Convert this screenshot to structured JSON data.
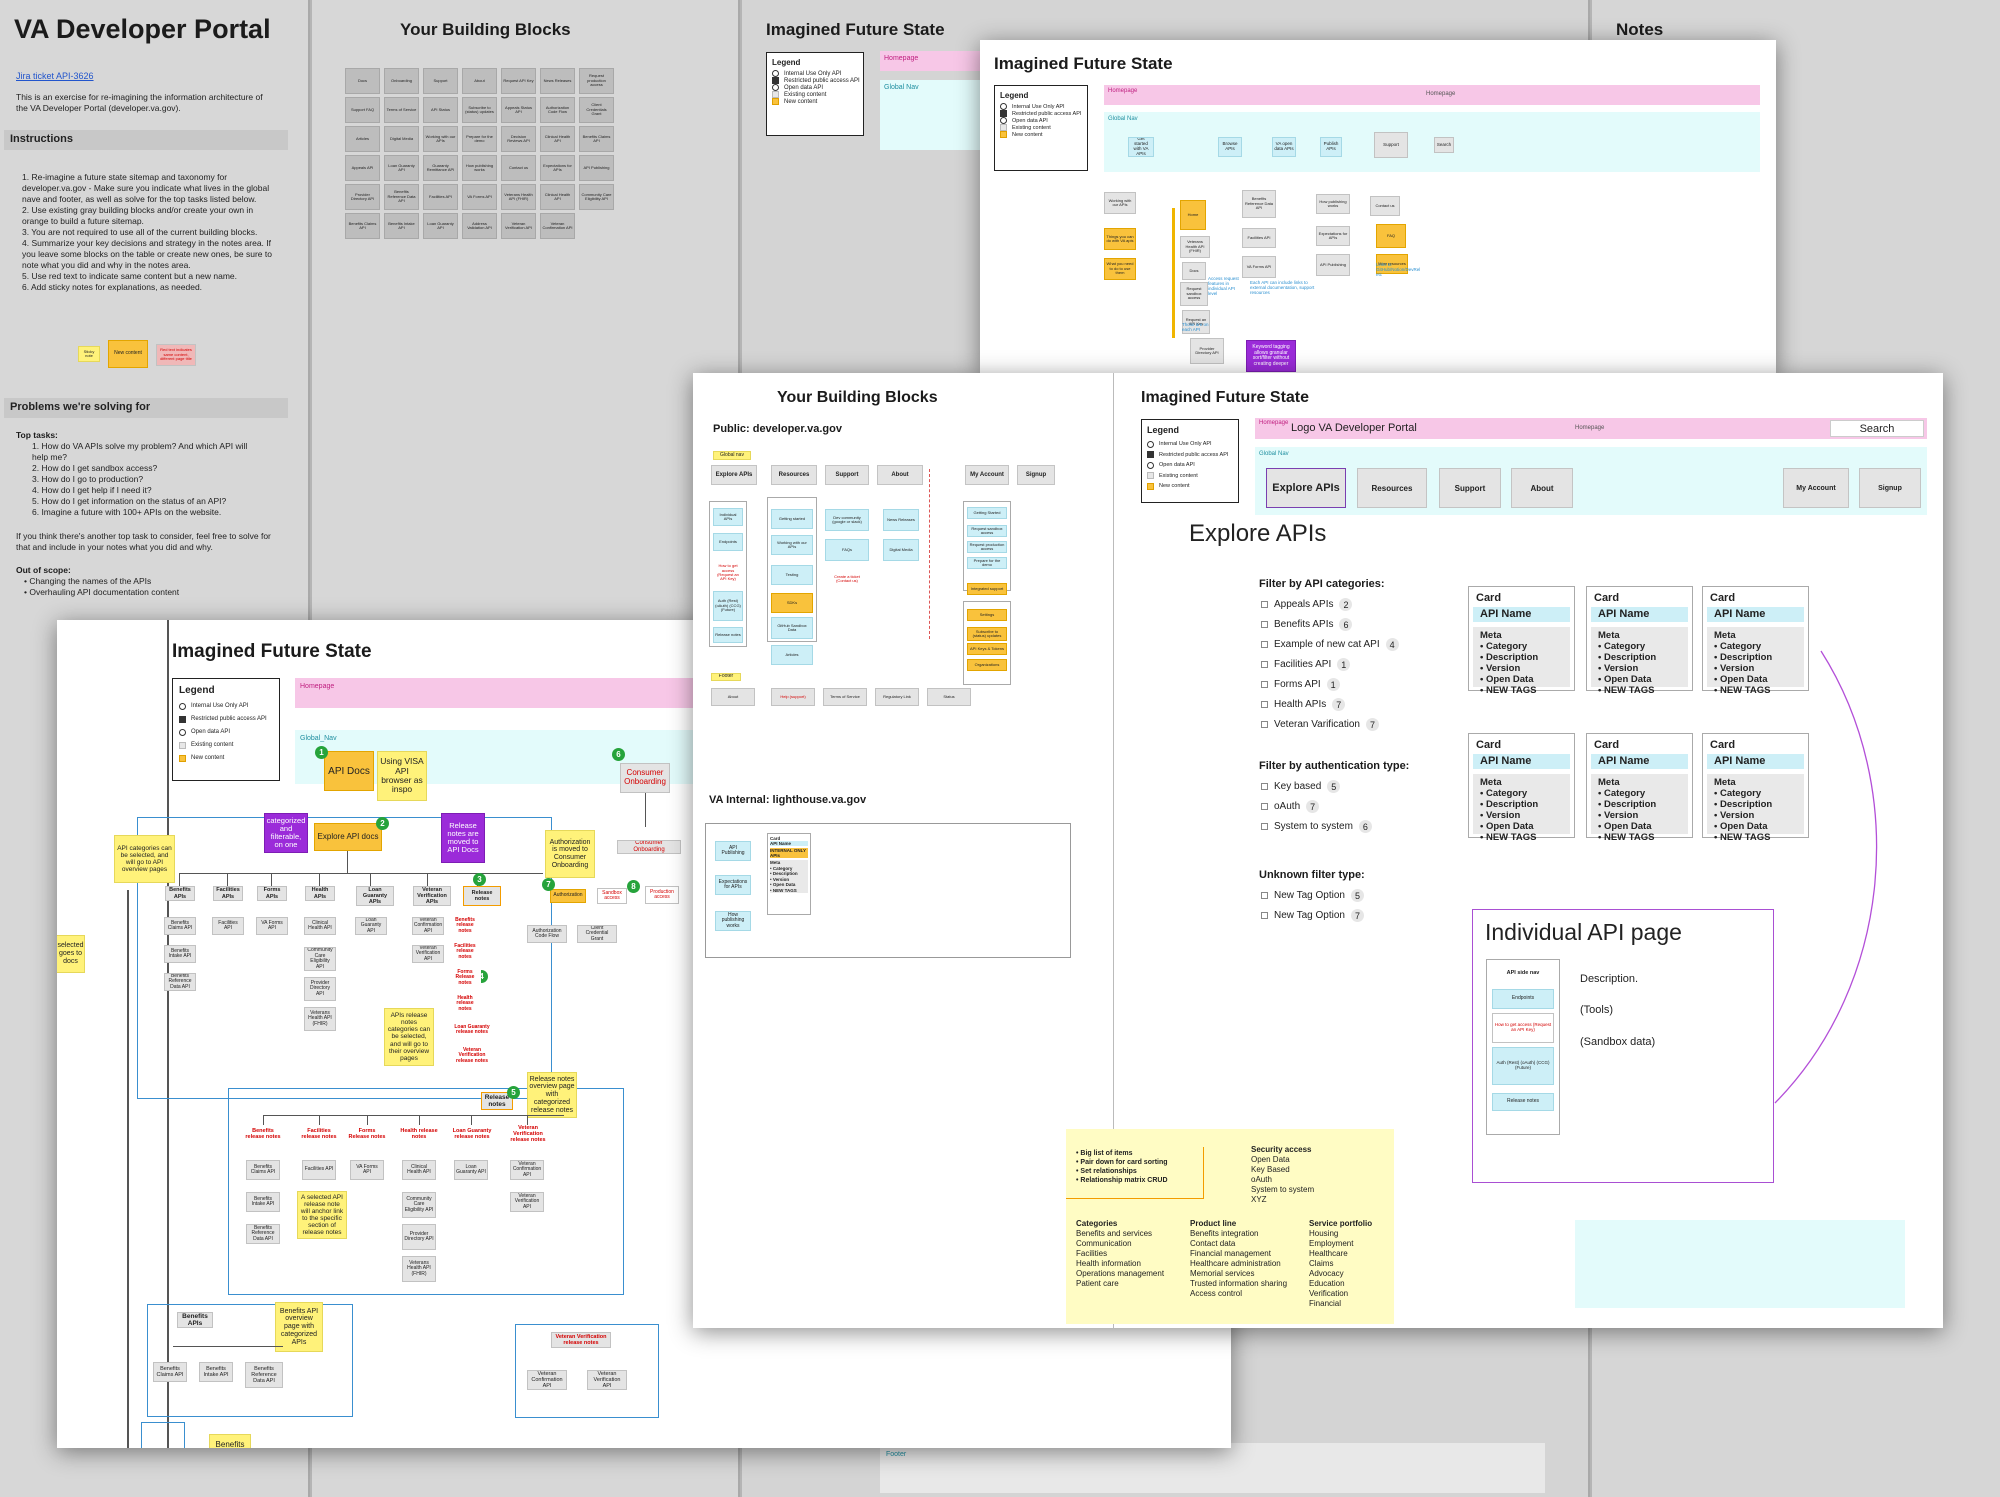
{
  "portal": {
    "title": "VA Developer Portal",
    "jira_link": "Jira ticket API-3626",
    "intro": "This is an exercise for re-imagining the information architecture of the VA Developer Portal (developer.va.gov).",
    "instructions_heading": "Instructions",
    "instructions": [
      "1. Re-imagine a future state sitemap and taxonomy for developer.va.gov - Make sure you indicate what lives in the global nave and footer, as well as solve for the top tasks listed below.",
      "2. Use existing gray building blocks and/or create your own in orange to build a future sitemap.",
      "3. You are not required to use all of the current building blocks.",
      "4. Summarize your key decisions and strategy in the notes area. If you leave some blocks on the table or create new ones, be sure to note what you did and why in the notes area.",
      "5. Use red text to indicate same content but a new name.",
      "6. Add sticky notes for explanations, as needed."
    ],
    "swatches": [
      "Sticky note",
      "New content",
      "Red text indicates same content, different page title"
    ],
    "problems_heading": "Problems we're solving for",
    "top_tasks_label": "Top tasks:",
    "top_tasks": [
      "1. How do VA APIs solve my problem? And which API will help me?",
      "2. How do I get sandbox access?",
      "3. How do I go to production?",
      "4. How do I get help if I need it?",
      "5. How do I get information on the status of an API?",
      "6. Imagine a future with 100+ APIs on the website."
    ],
    "other_task_note": "If you think there's another top task to consider, feel free to solve for that and include in your notes what you did and why.",
    "out_of_scope_label": "Out of scope:",
    "out_of_scope": [
      "Changing the names of the APIs",
      "Overhauling API documentation content"
    ]
  },
  "bg_headers": {
    "building_blocks": "Your Building Blocks",
    "future_state": "Imagined Future State",
    "notes": "Notes",
    "footer": "Footer"
  },
  "legend": {
    "title": "Legend",
    "items": [
      "Internal Use Only API",
      "Restricted public access API",
      "Open data API",
      "Existing content",
      "New content"
    ]
  },
  "bg_blocks": [
    "Docs",
    "Onboarding",
    "Support",
    "About",
    "Request API Key",
    "News Releases",
    "Request production access",
    "Support FAQ",
    "Terms of Service",
    "API Status",
    "Subscribe to (status) updates",
    "Appeals Status API",
    "Authorization Code Flow",
    "Client Credentials Grant",
    "Articles",
    "Digital Media",
    "Working with our APIs",
    "Prepare for the demo",
    "Decision Reviews API",
    "Clinical Health API",
    "Benefits Claims API",
    "Appeals API",
    "Loan Guaranty API",
    "Guaranty Remittance API",
    "How publishing works",
    "Contact us",
    "Expectations for APIs",
    "API Publishing",
    "Provider Directory API",
    "Benefits Reference Data API",
    "Facilities API",
    "VA Forms API",
    "Veterans Health API (FHIR)",
    "Clinical Health API",
    "Community Care Eligibility API",
    "Benefits Claims API",
    "Benefits Intake API",
    "Loan Guaranty API",
    "Address Validation API",
    "Veteran Verification API",
    "Veteran Confirmation API"
  ],
  "top_sheet": {
    "title": "Imagined Future State",
    "homepage": "Homepage",
    "global_nav": "Global Nav",
    "nav": [
      "Get started with VA APIs",
      "Browse APIs",
      "VA open data APIs",
      "Publish APIs",
      "Support",
      "Search"
    ],
    "tree": [
      "Working with our APIs",
      "Home",
      "Benefits Reference Data API",
      "How publishing works",
      "Contact us",
      "Things you can do with VA apis",
      "Veterans Health API (FHIR)",
      "Facilities API",
      "Expectations for APIs",
      "FAQ",
      "What you need to do to use them",
      "Docs",
      "VA Forms API",
      "API Publishing",
      "More resources",
      "Request sandbox access",
      "Request an API Key",
      "Provider Directory API"
    ],
    "notes": [
      "Access request features in individual API level",
      "Each API can include links to external documentation, support resources",
      "Keyword tagging allows granular sort/filter without creating deeper",
      "Links to GitHub/Notion/DevRel etc",
      "Those are on each API"
    ]
  },
  "mid_sheet": {
    "blocks_title": "Your Building Blocks",
    "public_label": "Public: developer.va.gov",
    "global_nav_tag": "Global nav",
    "nav": [
      "Explore APIs",
      "Resources",
      "Support",
      "About",
      "My Account",
      "Signup"
    ],
    "explore_col": [
      "Individual APIs",
      "Endpoints",
      "How to get access (Request an API Key)",
      "Auth (Rest) (oAuth) (CCG) (Future)",
      "Release notes"
    ],
    "resources_col": [
      "Getting started",
      "Working with our APIs",
      "Testing",
      "SDKs",
      "GitHub Sandbox Data",
      "Articles"
    ],
    "support_col": [
      "Dev community (google or slack)",
      "FAQs",
      "Create a ticket (Contact us)"
    ],
    "about_col": [
      "News Releases",
      "Digital Media"
    ],
    "account_col": [
      "Getting Started",
      "Request sandbox access",
      "Request production access",
      "Prepare for the demo",
      "Integrated support",
      "Settings",
      "Subscribe to (status) updates",
      "API Keys & Tokens",
      "Organizations"
    ],
    "footer_tag": "Footer",
    "footer": [
      "About",
      "Help (support)",
      "Terms of Service",
      "Regulatory Link",
      "Status"
    ],
    "internal_label": "VA Internal: lighthouse.va.gov",
    "internal": [
      "API Publishing",
      "Expectations for APIs",
      "How publishing works"
    ],
    "internal_card": [
      "Card",
      "API Name",
      "INTERNAL ONLY APIs",
      "Meta",
      "• Category",
      "• Description",
      "• Version",
      "• Open Data",
      "• NEW TAGS"
    ],
    "future_title": "Imagined Future State",
    "homepage_tag": "Homepage",
    "logo_text": "Logo VA Developer Portal",
    "homepage_center": "Homepage",
    "search": "Search",
    "global_nav": "Global Nav",
    "explore_heading": "Explore APIs",
    "filter_cat_heading": "Filter by API categories:",
    "filter_cats": [
      {
        "label": "Appeals APIs",
        "count": "2"
      },
      {
        "label": "Benefits APIs",
        "count": "6"
      },
      {
        "label": "Example of new cat API",
        "count": "4"
      },
      {
        "label": "Facilities API",
        "count": "1"
      },
      {
        "label": "Forms API",
        "count": "1"
      },
      {
        "label": "Health APIs",
        "count": "7"
      },
      {
        "label": "Veteran Varification",
        "count": "7"
      }
    ],
    "filter_auth_heading": "Filter by authentication type:",
    "filter_auth": [
      {
        "label": "Key based",
        "count": "5"
      },
      {
        "label": "oAuth",
        "count": "7"
      },
      {
        "label": "System to system",
        "count": "6"
      }
    ],
    "filter_unknown_heading": "Unknown filter type:",
    "filter_unknown": [
      {
        "label": "New Tag Option",
        "count": "5"
      },
      {
        "label": "New Tag Option",
        "count": "7"
      }
    ],
    "card": {
      "title": "Card",
      "name": "API Name",
      "meta": [
        "Meta",
        "• Category",
        "• Description",
        "• Version",
        "• Open Data",
        "• NEW TAGS"
      ]
    },
    "individual_heading": "Individual API page",
    "side_nav": [
      "API side nav",
      "Endpoints",
      "How to get access (Request an API Key)",
      "Auth (Rest) (oAuth) (CCG) (Future)",
      "Release notes"
    ],
    "desc": [
      "Description.",
      "(Tools)",
      "(Sandbox data)"
    ],
    "sticky": {
      "list": [
        "• Big list of items",
        "• Pair down for card sorting",
        "• Set relationships",
        "• Relationship matrix CRUD"
      ],
      "security_heading": "Security access",
      "security": [
        "Open Data",
        "Key Based",
        "oAuth",
        "System to system",
        "XYZ"
      ],
      "categories_heading": "Categories",
      "categories": [
        "Benefits and services",
        "Communication",
        "Facilities",
        "Health information",
        "Operations management",
        "Patient care"
      ],
      "product_heading": "Product line",
      "product": [
        "Benefits integration",
        "Contact data",
        "Financial management",
        "Healthcare administration",
        "Memorial services",
        "Trusted information sharing",
        "Access control"
      ],
      "service_heading": "Service portfolio",
      "service": [
        "Housing",
        "Employment",
        "Healthcare",
        "Claims",
        "Advocacy",
        "Education",
        "Verification",
        "Financial"
      ]
    }
  },
  "bottom_sheet": {
    "title": "Imagined Future State",
    "homepage": "Homepage",
    "global_nav": "Global_Nav",
    "api_docs": "API Docs",
    "visa_note": "Using VISA API browser as inspo",
    "consumer_onboarding": "Consumer Onboarding",
    "consumer_onboarding2": "Consumer Onboarding",
    "categorized_note": "APIs are categorized and filterable, on one page",
    "explore_docs": "Explore API docs",
    "release_moved": "Release notes are moved to API Docs",
    "auth_moved": "Authorization is moved to Consumer Onboarding",
    "cat_note": "API categories can be selected, and will go to API overview pages",
    "selected_note": "selected goes to docs",
    "cats": [
      "Benefits APIs",
      "Facilities APIs",
      "Forms APIs",
      "Health APIs",
      "Loan Guaranty APIs",
      "Veteran Verification APIs",
      "Release notes"
    ],
    "cat_children": [
      [
        "Benefits Claims API",
        "Benefits Intake API",
        "Benefits Reference Data API"
      ],
      [
        "Facilities API"
      ],
      [
        "VA Forms API"
      ],
      [
        "Clinical Health API",
        "Community Care Eligibility API",
        "Provider Directory API",
        "Veterans Health API (FHIR)"
      ],
      [
        "Loan Guaranty API"
      ],
      [
        "Veteran Confirmation API",
        "Veteran Verification API"
      ]
    ],
    "release_list": [
      "Benefits release notes",
      "Facilities release notes",
      "Forms Release notes",
      "Health release notes",
      "Loan Guaranty release notes",
      "Veteran Verification release notes"
    ],
    "release_note_sticky": "APIs release notes categories can be selected, and will go to their overview pages",
    "auth_items": [
      "Authorization",
      "Sandbox access",
      "Production access",
      "Authorization Code Flow",
      "Client Credential Grant"
    ],
    "release_overview_note": "Release notes overview page with categorized release notes",
    "release_cats": [
      "Benefits release notes",
      "Facilities release notes",
      "Forms Release notes",
      "Health release notes",
      "Loan Guaranty release notes",
      "Veteran Verification release notes"
    ],
    "release_children": [
      [
        "Benefits Claims API",
        "Benefits Intake API",
        "Benefits Reference Data API"
      ],
      [
        "Facilities API"
      ],
      [
        "VA Forms API"
      ],
      [
        "Clinical Health API",
        "Community Care Eligibility API",
        "Provider Directory API",
        "Veterans Health API (FHIR)"
      ],
      [
        "Loan Guaranty API"
      ],
      [
        "Veteran Confirmation API",
        "Veteran Verification API"
      ]
    ],
    "anchor_note": "A selected API release note will anchor link to the specific section of release notes",
    "benefits_overview_note": "Benefits API overview page with categorized APIs",
    "benefits_apis": "Benefits APIs",
    "benefits_children": [
      "Benefits Claims API",
      "Benefits Intake API",
      "Benefits Reference Data API"
    ],
    "vv_release": "Veteran Verification release notes",
    "vv_children": [
      "Veteran Confirmation API",
      "Veteran Verification API"
    ],
    "benefits_sticky": "Benefits",
    "release_notes_box": "Release notes",
    "step_numbers": [
      "1",
      "2",
      "3",
      "4",
      "5",
      "6",
      "7",
      "8"
    ]
  }
}
